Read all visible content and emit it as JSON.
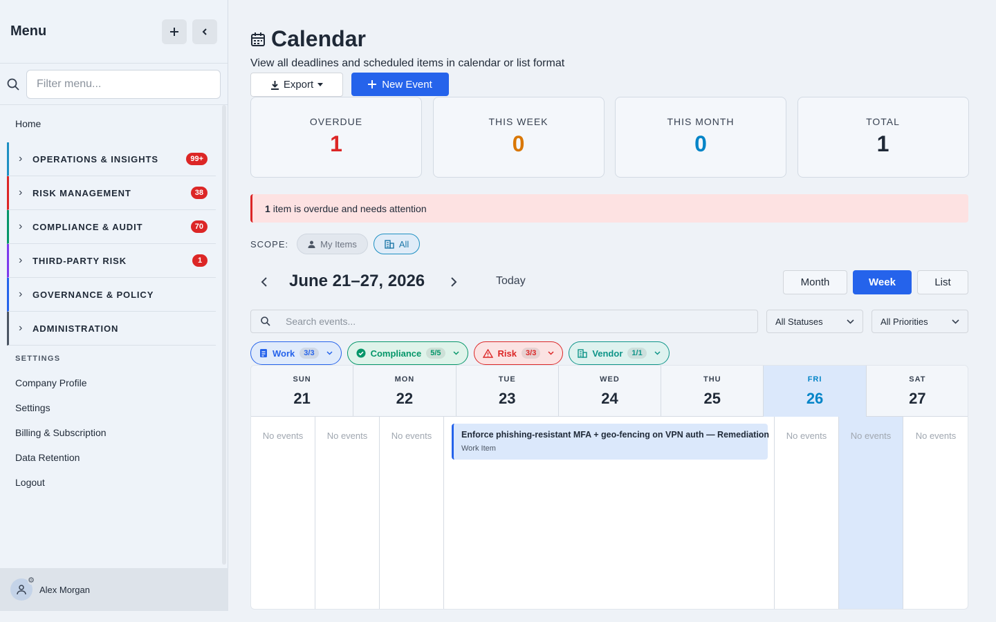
{
  "sidebar": {
    "title": "Menu",
    "filter_placeholder": "Filter menu...",
    "home": "Home",
    "groups": [
      {
        "label": "OPERATIONS & INSIGHTS",
        "badge": "99+",
        "color": "#1d8fc2"
      },
      {
        "label": "RISK MANAGEMENT",
        "badge": "38",
        "color": "#dc2626"
      },
      {
        "label": "COMPLIANCE & AUDIT",
        "badge": "70",
        "color": "#059669"
      },
      {
        "label": "THIRD-PARTY RISK",
        "badge": "1",
        "color": "#7c3aed"
      },
      {
        "label": "GOVERNANCE & POLICY",
        "badge": "",
        "color": "#2563eb"
      },
      {
        "label": "ADMINISTRATION",
        "badge": "",
        "color": "#4b5563"
      }
    ],
    "settings_heading": "SETTINGS",
    "settings_items": [
      "Company Profile",
      "Settings",
      "Billing & Subscription",
      "Data Retention",
      "Logout"
    ],
    "user_name": "Alex Morgan"
  },
  "header": {
    "title": "Calendar",
    "subtitle": "View all deadlines and scheduled items in calendar or list format",
    "export_label": "Export",
    "new_event_label": "New Event"
  },
  "stats": [
    {
      "label": "OVERDUE",
      "value": "1",
      "color": "#dc2626"
    },
    {
      "label": "THIS WEEK",
      "value": "0",
      "color": "#d97706"
    },
    {
      "label": "THIS MONTH",
      "value": "0",
      "color": "#0284c7"
    },
    {
      "label": "TOTAL",
      "value": "1",
      "color": "#1f2937"
    }
  ],
  "alert": {
    "count": "1",
    "text": "item is overdue and needs attention"
  },
  "scope": {
    "label": "SCOPE:",
    "my_items": "My Items",
    "all": "All"
  },
  "week": {
    "title": "June 21–27, 2026",
    "today": "Today",
    "views": [
      "Month",
      "Week",
      "List"
    ],
    "active_view": "Week"
  },
  "search": {
    "placeholder": "Search events...",
    "status_filter": "All Statuses",
    "priority_filter": "All Priorities"
  },
  "chips": [
    {
      "label": "Work",
      "count": "3/3",
      "color": "#2563eb",
      "bg": "#e0ebfb"
    },
    {
      "label": "Compliance",
      "count": "5/5",
      "color": "#059669",
      "bg": "#dff3ea"
    },
    {
      "label": "Risk",
      "count": "3/3",
      "color": "#dc2626",
      "bg": "#fbe3e3"
    },
    {
      "label": "Vendor",
      "count": "1/1",
      "color": "#0d9488",
      "bg": "#def2ef"
    }
  ],
  "calendar": {
    "days": [
      {
        "name": "SUN",
        "date": "21",
        "today": false
      },
      {
        "name": "MON",
        "date": "22",
        "today": false
      },
      {
        "name": "TUE",
        "date": "23",
        "today": false
      },
      {
        "name": "WED",
        "date": "24",
        "today": false
      },
      {
        "name": "THU",
        "date": "25",
        "today": false
      },
      {
        "name": "FRI",
        "date": "26",
        "today": true
      },
      {
        "name": "SAT",
        "date": "27",
        "today": false
      }
    ],
    "no_events_label": "No events",
    "event": {
      "title": "Enforce phishing-resistant MFA + geo-fencing on VPN auth — Remediation",
      "type": "Work Item"
    }
  }
}
